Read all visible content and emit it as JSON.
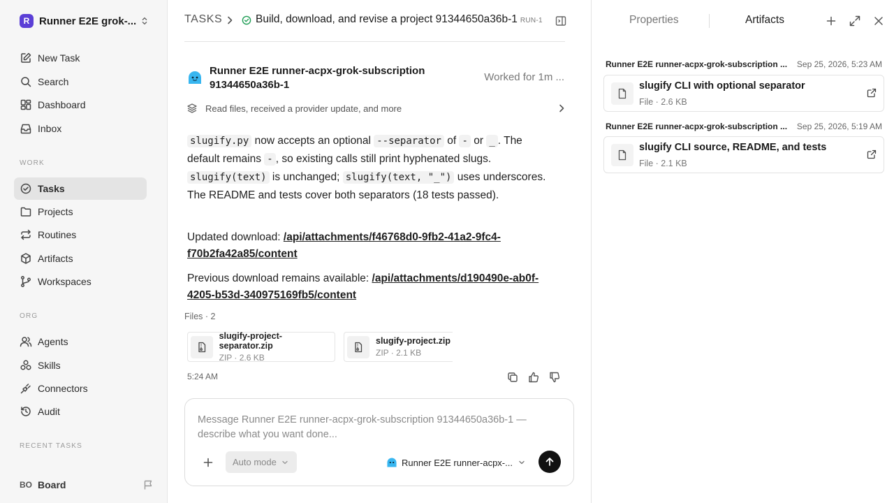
{
  "workspace": {
    "logo_letter": "R",
    "name": "Runner E2E grok-..."
  },
  "sidebar": {
    "top_items": [
      {
        "label": "New Task",
        "icon": "edit-icon"
      },
      {
        "label": "Search",
        "icon": "search-icon"
      },
      {
        "label": "Dashboard",
        "icon": "dashboard-icon"
      },
      {
        "label": "Inbox",
        "icon": "inbox-icon"
      }
    ],
    "work_label": "WORK",
    "work_items": [
      {
        "label": "Tasks",
        "icon": "check-circle-icon",
        "active": true
      },
      {
        "label": "Projects",
        "icon": "folder-icon"
      },
      {
        "label": "Routines",
        "icon": "repeat-icon"
      },
      {
        "label": "Artifacts",
        "icon": "cube-icon"
      },
      {
        "label": "Workspaces",
        "icon": "git-branch-icon"
      }
    ],
    "org_label": "ORG",
    "org_items": [
      {
        "label": "Agents",
        "icon": "users-icon"
      },
      {
        "label": "Skills",
        "icon": "skills-icon"
      },
      {
        "label": "Connectors",
        "icon": "plug-icon"
      },
      {
        "label": "Audit",
        "icon": "history-icon"
      }
    ],
    "recent_label": "RECENT TASKS",
    "board": {
      "initials": "BO",
      "label": "Board"
    }
  },
  "header": {
    "crumb": "TASKS",
    "title": "Build, download, and revise a project 91344650a36b-1",
    "run": "RUN-1"
  },
  "message": {
    "agent_name": "Runner E2E runner-acpx-grok-subscription 91344650a36b-1",
    "worked": "Worked for 1m ...",
    "activity": "Read files, received a provider update, and more",
    "para1": {
      "code1": "slugify.py",
      "t1": " now accepts an optional ",
      "code2": "--separator",
      "t2": " of ",
      "code3": "-",
      "t3": " or ",
      "code4": "_",
      "t4": ". The default remains ",
      "code5": "-",
      "t5": ", so existing calls still print hyphenated slugs. ",
      "code6": "slugify(text)",
      "t6": " is unchanged; ",
      "code7": "slugify(text, \"_\")",
      "t7": " uses underscores. The README and tests cover both separators (18 tests passed)."
    },
    "updated_label": "Updated download: ",
    "updated_link": "/api/attachments/f46768d0-9fb2-41a2-9fc4-f70b2fa42a85/content",
    "previous_label": "Previous download remains available: ",
    "previous_link": "/api/attachments/d190490e-ab0f-4205-b53d-340975169fb5/content",
    "files_label": "Files · 2",
    "files": [
      {
        "name": "slugify-project-separator.zip",
        "meta": "ZIP · 2.6 KB"
      },
      {
        "name": "slugify-project.zip",
        "meta": "ZIP · 2.1 KB"
      }
    ],
    "time": "5:24 AM"
  },
  "composer": {
    "placeholder": "Message Runner E2E runner-acpx-grok-subscription 91344650a36b-1 — describe what you want done...",
    "mode": "Auto mode",
    "agent": "Runner E2E runner-acpx-..."
  },
  "right_panel": {
    "tabs": [
      "Properties",
      "Artifacts"
    ],
    "active_tab": "Artifacts",
    "artifacts": [
      {
        "source": "Runner E2E runner-acpx-grok-subscription ...",
        "date": "Sep 25, 2026, 5:23 AM",
        "title": "slugify CLI with optional separator",
        "meta": "File · 2.6 KB"
      },
      {
        "source": "Runner E2E runner-acpx-grok-subscription ...",
        "date": "Sep 25, 2026, 5:19 AM",
        "title": "slugify CLI source, README, and tests",
        "meta": "File · 2.1 KB"
      }
    ]
  },
  "colors": {
    "accent": "#5b3fd6",
    "success": "#1f9d55",
    "send": "#111111"
  }
}
